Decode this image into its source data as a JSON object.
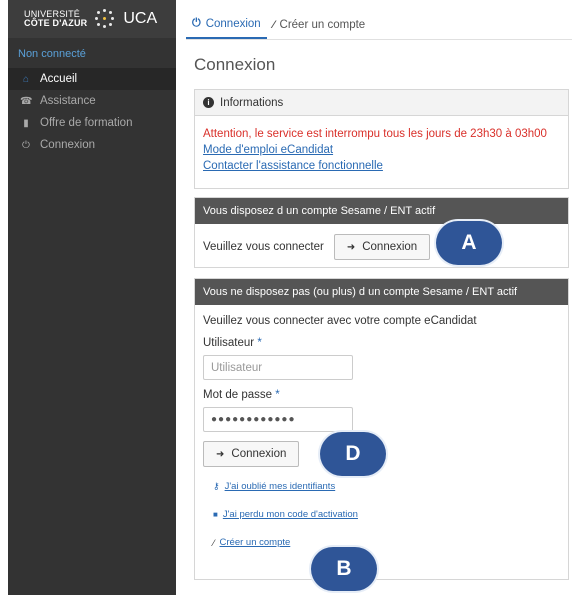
{
  "brand": {
    "univ_line1": "UNIVERSITÉ",
    "univ_line2": "CÔTE D'AZUR",
    "name": "UCA",
    "logo_icon": "dots-logo-icon"
  },
  "sidebar": {
    "status": "Non connecté",
    "items": [
      {
        "label": "Accueil",
        "icon": "home-icon",
        "active": true
      },
      {
        "label": "Assistance",
        "icon": "assistance-icon",
        "active": false
      },
      {
        "label": "Offre de formation",
        "icon": "bookmark-icon",
        "active": false
      },
      {
        "label": "Connexion",
        "icon": "power-icon",
        "active": false
      }
    ]
  },
  "tabs": [
    {
      "label": "Connexion",
      "icon": "power-icon",
      "active": true
    },
    {
      "label": "Créer un compte",
      "icon": "magic-wand-icon",
      "active": false
    }
  ],
  "page_title": "Connexion",
  "info_panel": {
    "title": "Informations",
    "warning": "Attention, le service est interrompu tous les jours de 23h30 à 03h00",
    "link1": "Mode d'emploi eCandidat",
    "link2": "Contacter l'assistance fonctionnelle"
  },
  "sesame_panel": {
    "title": "Vous disposez d un compte Sesame / ENT actif",
    "prompt": "Veuillez vous connecter",
    "button": "Connexion"
  },
  "local_panel": {
    "title": "Vous ne disposez pas (ou plus) d un compte Sesame / ENT actif",
    "prompt": "Veuillez vous connecter avec votre compte eCandidat",
    "user_label": "Utilisateur",
    "user_placeholder": "Utilisateur",
    "pw_label": "Mot de passe",
    "pw_value": "●●●●●●●●●●●●",
    "required_mark": "*",
    "button": "Connexion",
    "forgot_ids": "J'ai oublié mes identifiants",
    "lost_code": "J'ai perdu mon code d'activation",
    "create_account": "Créer un compte"
  },
  "badges": {
    "a": "A",
    "b": "B",
    "d": "D"
  },
  "colors": {
    "sidebar_bg": "#333333",
    "accent_blue": "#2a6ab3",
    "warning_red": "#d9302a",
    "dark_header": "#555555",
    "badge_blue": "#2f5597"
  }
}
